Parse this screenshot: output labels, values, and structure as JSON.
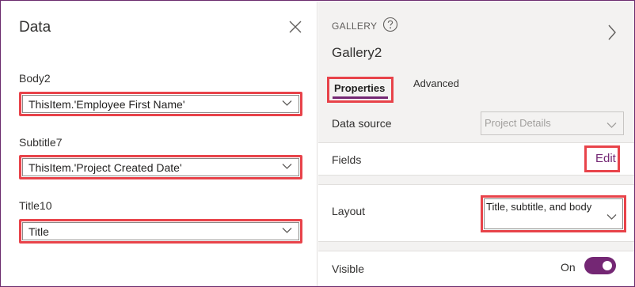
{
  "left_panel": {
    "title": "Data",
    "fields": [
      {
        "label": "Body2",
        "value": "ThisItem.'Employee First Name'"
      },
      {
        "label": "Subtitle7",
        "value": "ThisItem.'Project Created Date'"
      },
      {
        "label": "Title10",
        "value": "Title"
      }
    ]
  },
  "right_panel": {
    "control_type": "GALLERY",
    "control_name": "Gallery2",
    "tabs": [
      "Properties",
      "Advanced"
    ],
    "active_tab": "Properties",
    "data_source": {
      "label": "Data source",
      "value": "Project Details"
    },
    "fields": {
      "label": "Fields",
      "action": "Edit"
    },
    "layout": {
      "label": "Layout",
      "value": "Title, subtitle, and body"
    },
    "visible": {
      "label": "Visible",
      "state": "On",
      "on": true
    }
  },
  "colors": {
    "accent": "#742774",
    "highlight_border": "#e8434a",
    "panel_bg": "#f3f2f1"
  }
}
